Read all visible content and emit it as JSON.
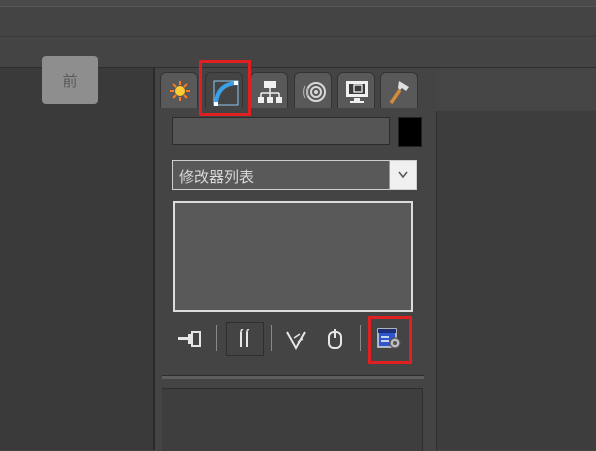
{
  "viewport": {
    "label": "前"
  },
  "command_panel": {
    "tabs": [
      {
        "name": "create",
        "icon": "sun-star-icon",
        "active": false
      },
      {
        "name": "modify",
        "icon": "curve-arc-icon",
        "active": true
      },
      {
        "name": "hierarchy",
        "icon": "hierarchy-icon",
        "active": false
      },
      {
        "name": "motion",
        "icon": "motion-rings-icon",
        "active": false
      },
      {
        "name": "display",
        "icon": "monitor-icon",
        "active": false
      },
      {
        "name": "utilities",
        "icon": "hammer-icon",
        "active": false
      }
    ],
    "object_name_value": "",
    "object_color": "#000000",
    "modifier_list": {
      "selected": "修改器列表"
    },
    "stack_tools": [
      {
        "name": "pin-stack",
        "icon": "pin-icon"
      },
      {
        "name": "show-end-result",
        "icon": "end-result-icon"
      },
      {
        "name": "make-unique",
        "icon": "make-unique-icon"
      },
      {
        "name": "remove-modifier",
        "icon": "remove-modifier-icon"
      },
      {
        "name": "configure-modifier-sets",
        "icon": "configure-sets-icon"
      }
    ]
  },
  "colors": {
    "highlight": "#e02020",
    "accent_blue": "#3aa0e8",
    "panel_bg": "#444444"
  }
}
